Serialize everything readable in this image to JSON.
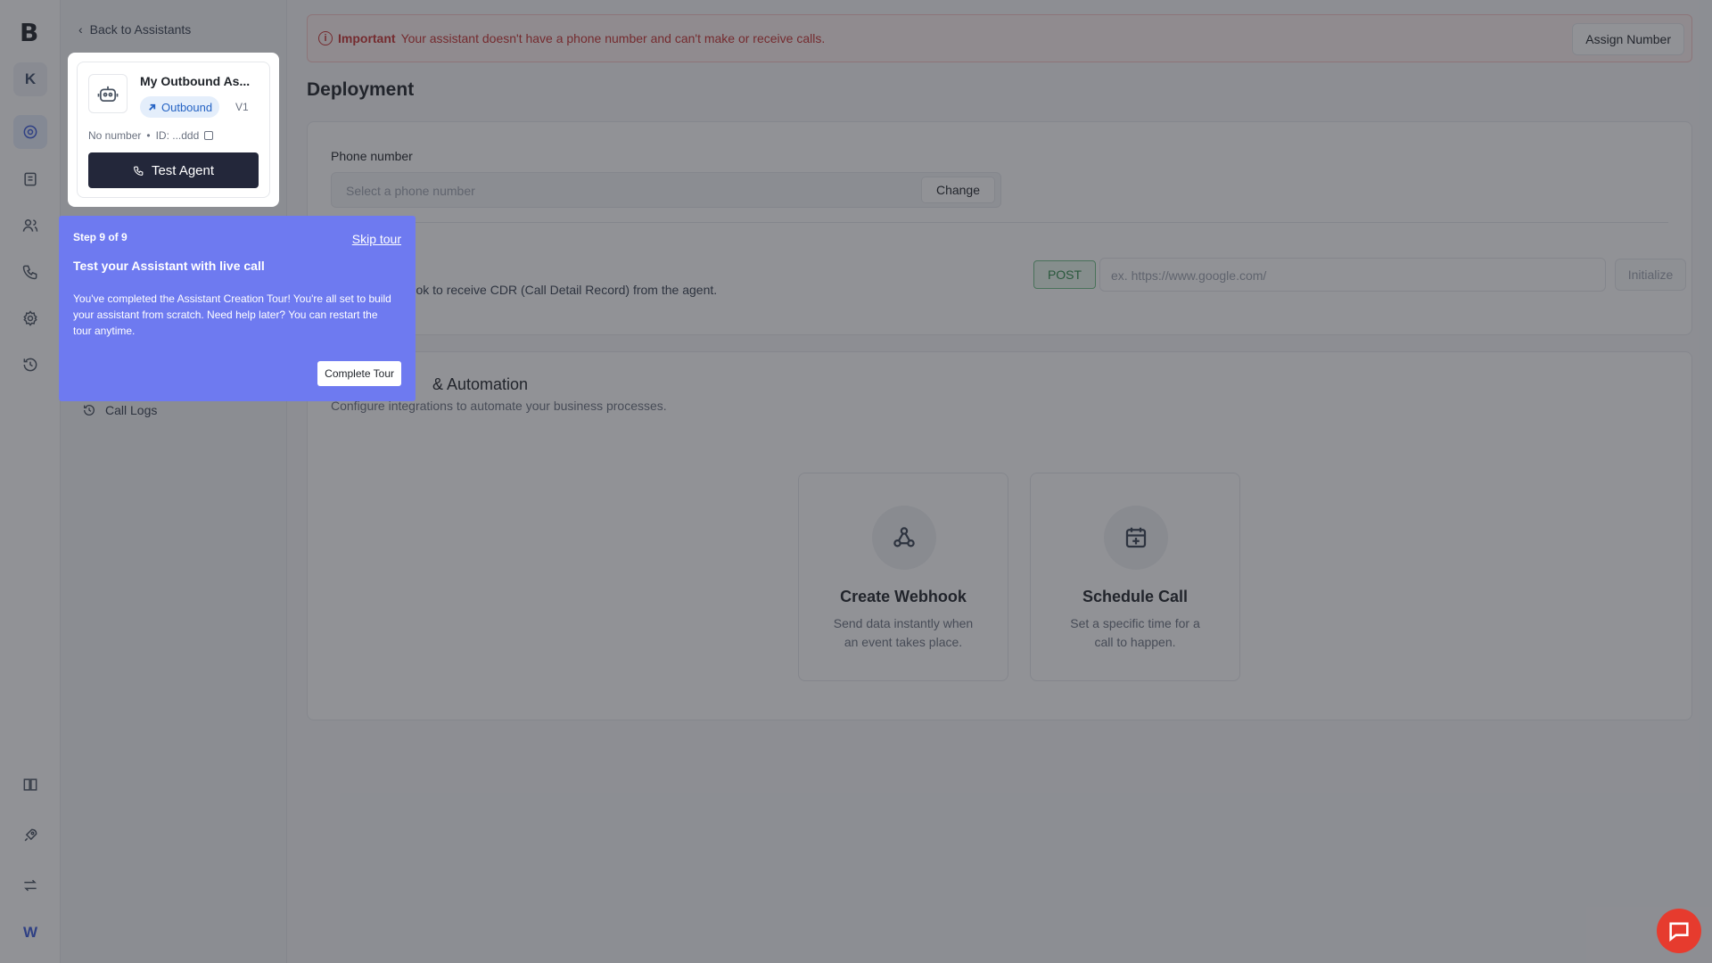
{
  "rail": {
    "logo": "B",
    "workspace_initial": "K",
    "user_initial": "W"
  },
  "sidebar": {
    "back_label": "Back to Assistants",
    "call_logs_label": "Call Logs"
  },
  "alert": {
    "label": "Important",
    "message": "Your assistant doesn't have a phone number and can't make or receive calls.",
    "assign_label": "Assign Number"
  },
  "page": {
    "title": "Deployment"
  },
  "phone": {
    "label": "Phone number",
    "placeholder": "Select a phone number",
    "change_label": "Change"
  },
  "webhook": {
    "description_fragment": "for your Webhook to receive CDR (Call Detail Record) from the agent.",
    "method": "POST",
    "url_placeholder": "ex. https://www.google.com/",
    "initialize_label": "Initialize"
  },
  "integrations": {
    "title_fragment": "& Automation",
    "subtitle": "Configure integrations to automate your business processes.",
    "tiles": [
      {
        "title": "Create Webhook",
        "desc_line1": "Send data instantly when",
        "desc_line2": "an event takes place."
      },
      {
        "title": "Schedule Call",
        "desc_line1": "Set a specific time for a",
        "desc_line2": "call to happen."
      }
    ]
  },
  "agent": {
    "name": "My Outbound As...",
    "direction": "Outbound",
    "version": "V1",
    "number": "No number",
    "separator": "•",
    "id": "ID: ...ddd",
    "test_label": "Test Agent"
  },
  "tour": {
    "step": "Step 9 of 9",
    "skip_label": "Skip tour",
    "title": "Test your Assistant with live call",
    "body": "You've completed the Assistant Creation Tour! You're all set to build your assistant from scratch. Need help later? You can restart the tour anytime.",
    "complete_label": "Complete Tour"
  },
  "colors": {
    "tour_bg": "#6e7af0",
    "alert_red": "#c53030",
    "chat_red": "#e63b2e",
    "button_dark": "#23273a"
  }
}
